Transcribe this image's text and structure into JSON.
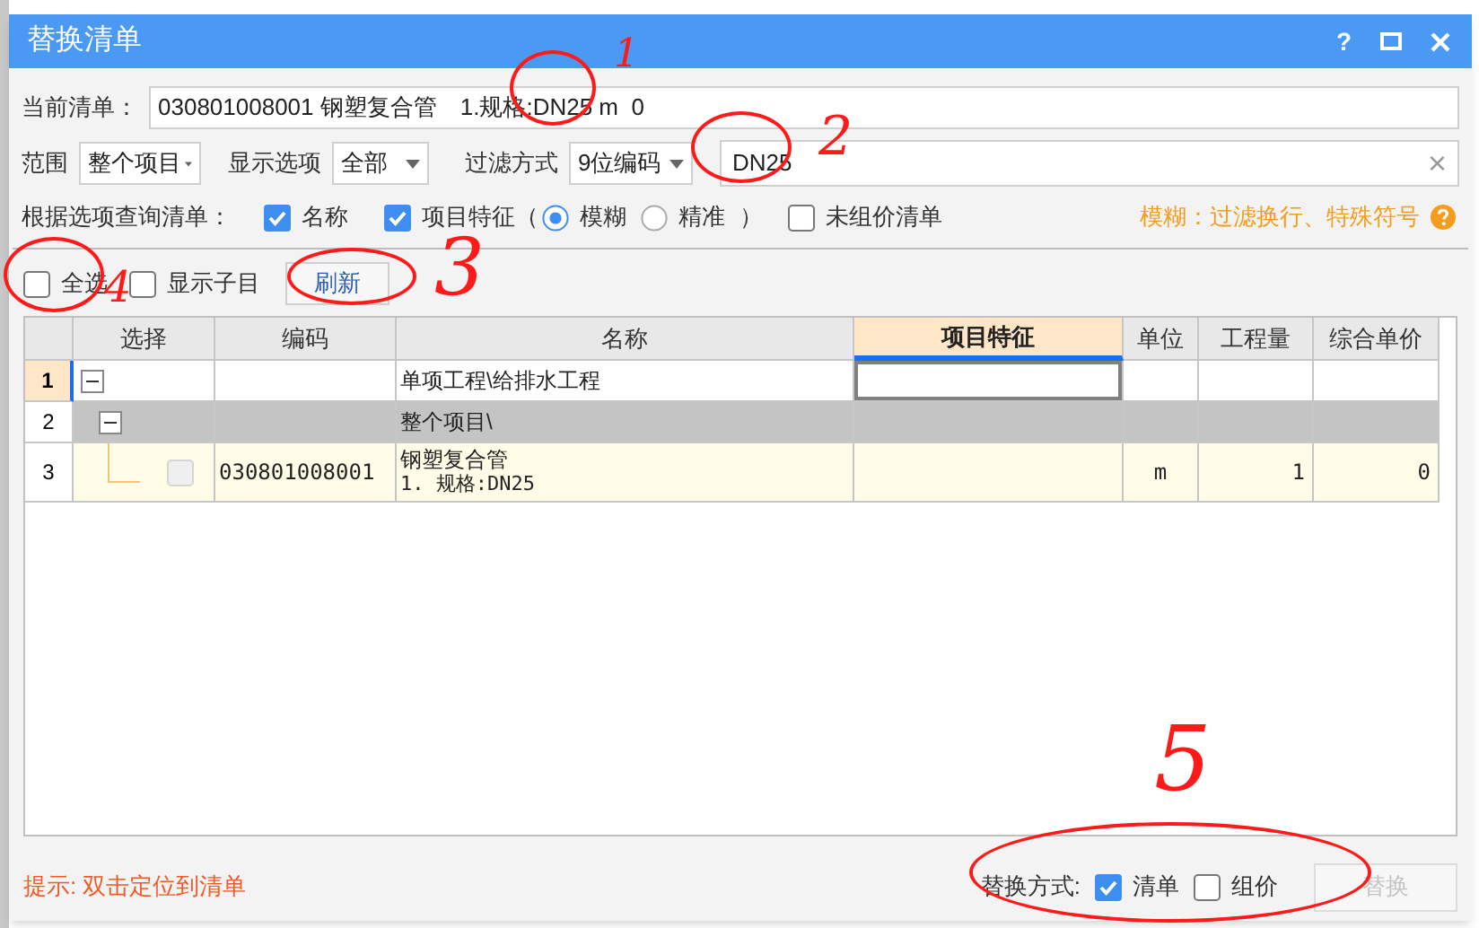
{
  "window": {
    "title": "替换清单",
    "help": "?"
  },
  "current_list": {
    "label": "当前清单：",
    "value": "030801008001 钢塑复合管　1.规格:DN25 m  0"
  },
  "filters": [
    {
      "label": "范围",
      "value": "整个项目"
    },
    {
      "label": "显示选项",
      "value": "全部"
    },
    {
      "label": "过滤方式",
      "value": "9位编码"
    }
  ],
  "search": {
    "value": "DN25",
    "clear": "×"
  },
  "query": {
    "label": "根据选项查询清单：",
    "name": {
      "label": "名称",
      "checked": true
    },
    "feature": {
      "label": "项目特征",
      "checked": true
    },
    "open_paren": "（",
    "modes": [
      {
        "label": "模糊",
        "selected": true
      },
      {
        "label": "精准",
        "selected": false
      }
    ],
    "close_paren": "）",
    "unpriced": {
      "label": "未组价清单",
      "checked": false
    },
    "hint": "模糊：过滤换行、特殊符号"
  },
  "toolbar": {
    "select_all": {
      "label": "全选",
      "checked": false
    },
    "show_sub": {
      "label": "显示子目",
      "checked": false
    },
    "refresh": "刷新"
  },
  "table": {
    "columns": [
      {
        "highlighted": false
      },
      {
        "label": "选择",
        "highlighted": false
      },
      {
        "label": "编码",
        "highlighted": false
      },
      {
        "label": "名称",
        "highlighted": false
      },
      {
        "label": "项目特征",
        "highlighted": true
      },
      {
        "label": "单位",
        "highlighted": false
      },
      {
        "label": "工程量",
        "highlighted": false
      },
      {
        "label": "综合单价",
        "highlighted": false
      }
    ],
    "rows": [
      {
        "num": "1",
        "kind": "group",
        "current": true,
        "expanded": true,
        "name": "单项工程\\给排水工程",
        "children": [
          {
            "num": "2",
            "kind": "group",
            "current": false,
            "expanded": true,
            "name": "整个项目\\",
            "children": [
              {
                "num": "3",
                "kind": "item",
                "current": false,
                "checked": false,
                "code": "030801008001",
                "name": "钢塑复合管",
                "spec": "1. 规格:DN25",
                "unit": "m",
                "quantity": "1",
                "price": "0"
              }
            ]
          }
        ]
      }
    ]
  },
  "footer": {
    "hint": "提示: 双击定位到清单",
    "mode_label": "替换方式:",
    "modes": [
      {
        "label": "清单",
        "checked": true
      },
      {
        "label": "组价",
        "checked": false
      }
    ],
    "replace": {
      "label": "替换",
      "disabled": true
    }
  },
  "annotations": [
    {
      "label": "1"
    },
    {
      "label": "2"
    },
    {
      "label": "3"
    },
    {
      "label": "4"
    },
    {
      "label": "5"
    }
  ]
}
